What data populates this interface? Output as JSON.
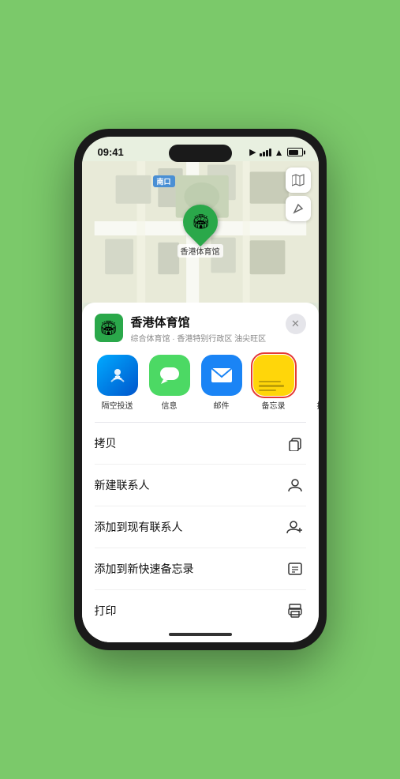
{
  "statusBar": {
    "time": "09:41",
    "location_icon": "▶"
  },
  "map": {
    "metro_label": "南口",
    "venue_pin_label": "香港体育馆",
    "map_btn_map": "🗺",
    "map_btn_location": "↗"
  },
  "bottomSheet": {
    "venue_name": "香港体育馆",
    "venue_subtitle": "综合体育馆 · 香港特别行政区 油尖旺区",
    "close_label": "✕"
  },
  "shareRow": [
    {
      "id": "airdrop",
      "label": "隔空投送",
      "bg": "airdrop"
    },
    {
      "id": "messages",
      "label": "信息",
      "bg": "messages"
    },
    {
      "id": "mail",
      "label": "邮件",
      "bg": "mail"
    },
    {
      "id": "notes",
      "label": "备忘录",
      "bg": "notes",
      "selected": true
    },
    {
      "id": "more",
      "label": "推",
      "bg": "more"
    }
  ],
  "actions": [
    {
      "id": "copy",
      "label": "拷贝",
      "icon": "⎘"
    },
    {
      "id": "new-contact",
      "label": "新建联系人",
      "icon": "👤"
    },
    {
      "id": "add-existing",
      "label": "添加到现有联系人",
      "icon": "👤+"
    },
    {
      "id": "add-notes",
      "label": "添加到新快速备忘录",
      "icon": "📋"
    },
    {
      "id": "print",
      "label": "打印",
      "icon": "🖨"
    }
  ]
}
